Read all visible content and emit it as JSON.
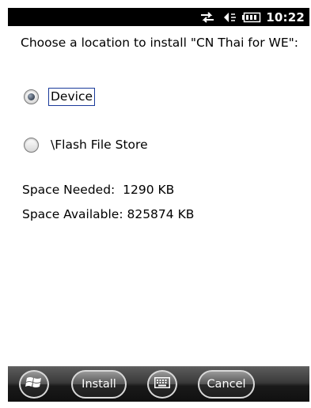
{
  "status_bar": {
    "time": "10:22",
    "icons": [
      "connectivity-arrows-icon",
      "speaker-icon",
      "battery-icon"
    ]
  },
  "dialog": {
    "prompt": "Choose a location to install \"CN Thai for WE\":",
    "options": [
      {
        "label": "Device",
        "selected": true
      },
      {
        "label": "\\Flash File Store",
        "selected": false
      }
    ],
    "space_needed": "Space Needed:  1290 KB",
    "space_available": "Space Available: 825874 KB"
  },
  "toolbar": {
    "install_label": "Install",
    "cancel_label": "Cancel",
    "icons": [
      "windows-start-icon",
      "keyboard-icon"
    ]
  }
}
